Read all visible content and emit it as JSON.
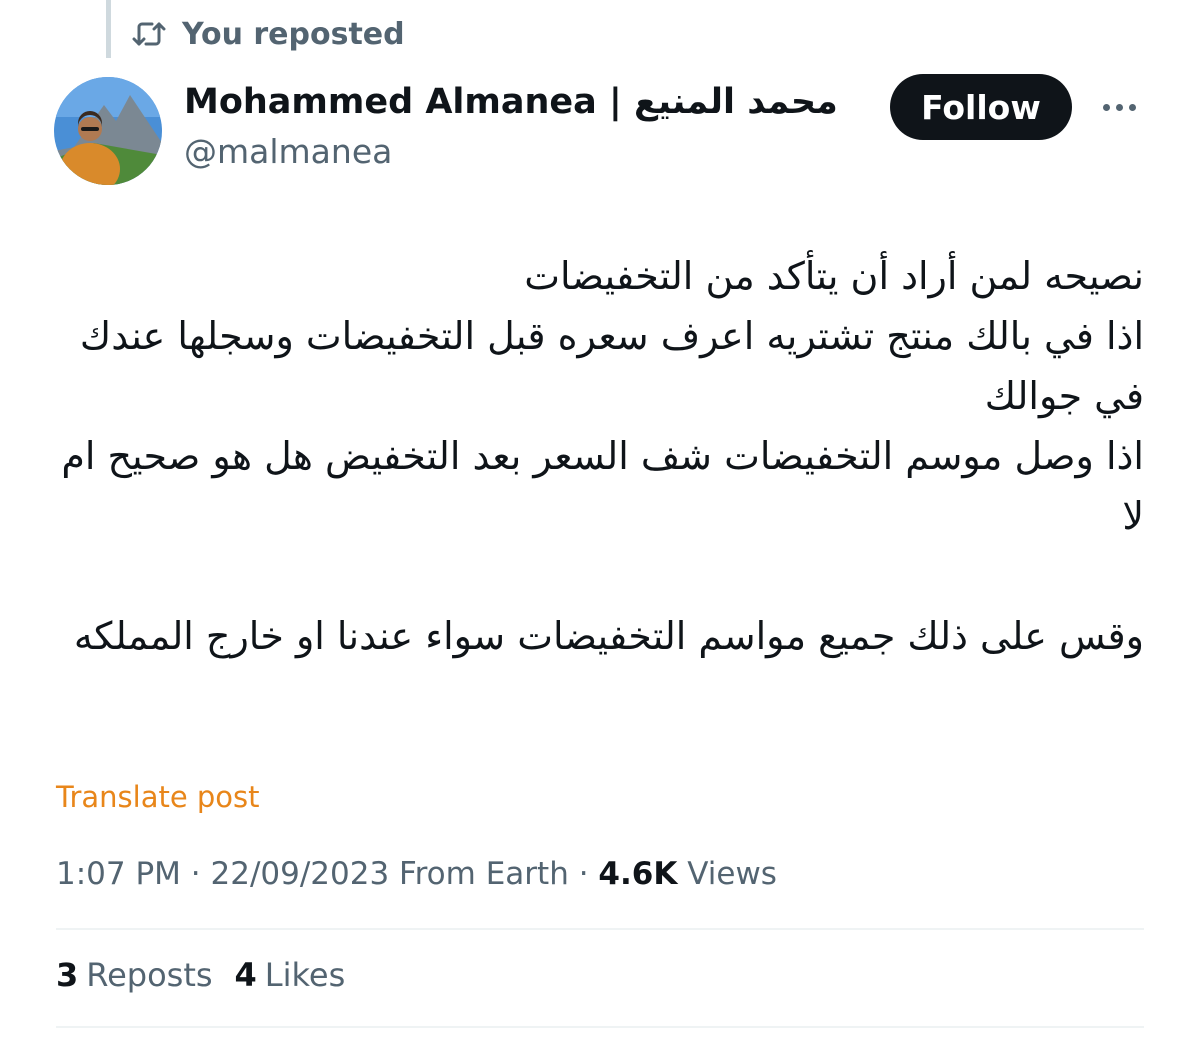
{
  "repost_banner": {
    "icon": "repost-icon",
    "label": "You reposted"
  },
  "author": {
    "display_name": "Mohammed Almanea | محمد المنيع",
    "handle": "@malmanea",
    "avatar": "avatar-photo"
  },
  "actions": {
    "follow_label": "Follow",
    "more_icon": "more-dots-icon"
  },
  "post": {
    "paragraphs": [
      "نصيحه لمن أراد أن يتأكد من التخفيضات\nاذا في بالك منتج تشتريه اعرف سعره قبل التخفيضات وسجلها عندك في جوالك\nاذا وصل موسم التخفيضات شف السعر بعد التخفيض هل هو صحيح ام لا",
      "وقس على ذلك جميع مواسم التخفيضات سواء عندنا او خارج المملكه"
    ],
    "translate_label": "Translate post"
  },
  "meta": {
    "time": "1:07 PM",
    "date": "22/09/2023",
    "source": "From Earth",
    "views_count": "4.6K",
    "views_label": "Views"
  },
  "stats": {
    "reposts_count": "3",
    "reposts_label": "Reposts",
    "likes_count": "4",
    "likes_label": "Likes"
  },
  "colors": {
    "text": "#0f1419",
    "secondary": "#536471",
    "translate": "#e8861a",
    "follow_bg": "#0f1419",
    "divider": "#eff3f4"
  }
}
